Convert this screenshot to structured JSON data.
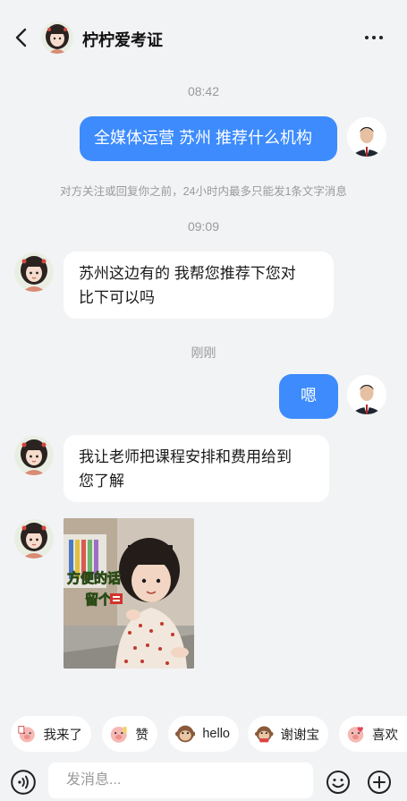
{
  "header": {
    "title": "柠柠爱考证"
  },
  "messages": {
    "time1": "08:42",
    "m1": "全媒体运营 苏州 推荐什么机构",
    "notice": "对方关注或回复你之前，24小时内最多只能发1条文字消息",
    "time2": "09:09",
    "m2_line1": "苏州这边有的 我帮您推荐下您对",
    "m2_line2": "比下可以吗",
    "time3": "刚刚",
    "m3": "嗯",
    "m4_line1": "我让老师把课程安排和费用给到",
    "m4_line2": "您了解",
    "photo_caption_1": "方便的话",
    "photo_caption_2": "留个"
  },
  "quick_replies": [
    {
      "label": "我来了",
      "icon": "pig-face-icon"
    },
    {
      "label": "赞",
      "icon": "pig-thumb-icon"
    },
    {
      "label": "hello",
      "icon": "monkey-face-icon"
    },
    {
      "label": "谢谢宝",
      "icon": "monkey-thanks-icon"
    },
    {
      "label": "喜欢",
      "icon": "pig-love-icon"
    }
  ],
  "input": {
    "placeholder": "发消息..."
  },
  "colors": {
    "bubble_blue": "#3d8bfd",
    "background": "#f2f3f5"
  }
}
